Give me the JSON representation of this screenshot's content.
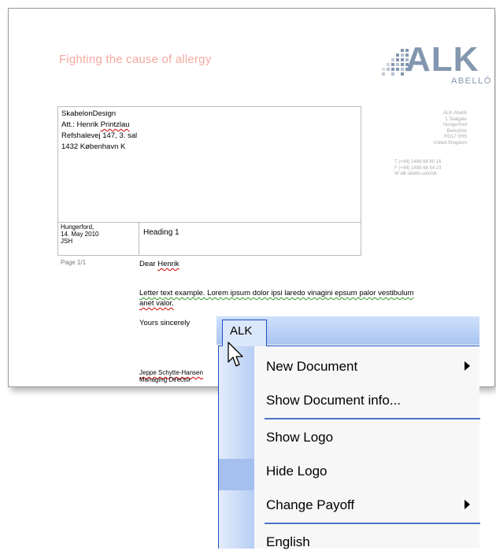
{
  "document": {
    "tagline": "Fighting the cause of allergy",
    "logo": {
      "main": "ALK",
      "sub": "ABELLÓ"
    },
    "recipient": {
      "line1": "SkabelonDesign",
      "line2_prefix": "Att.: Henrik ",
      "line2_name": "Printzlau",
      "line3": "Refshalevej 147, 3. sal",
      "line4": "1432 København K"
    },
    "meta": {
      "line1": "Hungerford,",
      "line2": "14. May 2010",
      "line3": "JSH"
    },
    "heading": "Heading 1",
    "company": {
      "name": "ALK-Abelló",
      "street": "1 Tealgate",
      "town": "Hungerford",
      "county": "Berkshire",
      "postcode": "RG17 0HS",
      "country": "United Kingdom"
    },
    "contact": {
      "phone": "T   (+44) 1488 68 60 16",
      "fax": "F   (+44) 1488 68 54 23",
      "web": "W   alk-abello.com/uk"
    },
    "page": "Page 1/1",
    "salutation": {
      "prefix": "Dear ",
      "name": "Henrik"
    },
    "body": {
      "part1": "Letter text example. Lorem ipsum dolor ipsi laredo vinagini epsum palor vestibulum",
      "part2": "anet valor."
    },
    "closing": "Yours sincerely",
    "signature": {
      "name": "Jeppe Schytte-Hansen",
      "title": "Managing Director"
    }
  },
  "menu": {
    "title": "ALK",
    "items": [
      {
        "label": "New Document",
        "has_submenu": true
      },
      {
        "label": "Show Document info...",
        "has_submenu": false
      },
      {
        "label": "Show Logo",
        "has_submenu": false
      },
      {
        "label": "Hide Logo",
        "has_submenu": false
      },
      {
        "label": "Change Payoff",
        "has_submenu": true
      },
      {
        "label": "English",
        "has_submenu": false
      }
    ]
  },
  "colors": {
    "tagline": "#f4a9a0",
    "logo": "#8497b0",
    "menu_border": "#1e4ebf",
    "menu_bar": "#a9c5f1"
  }
}
